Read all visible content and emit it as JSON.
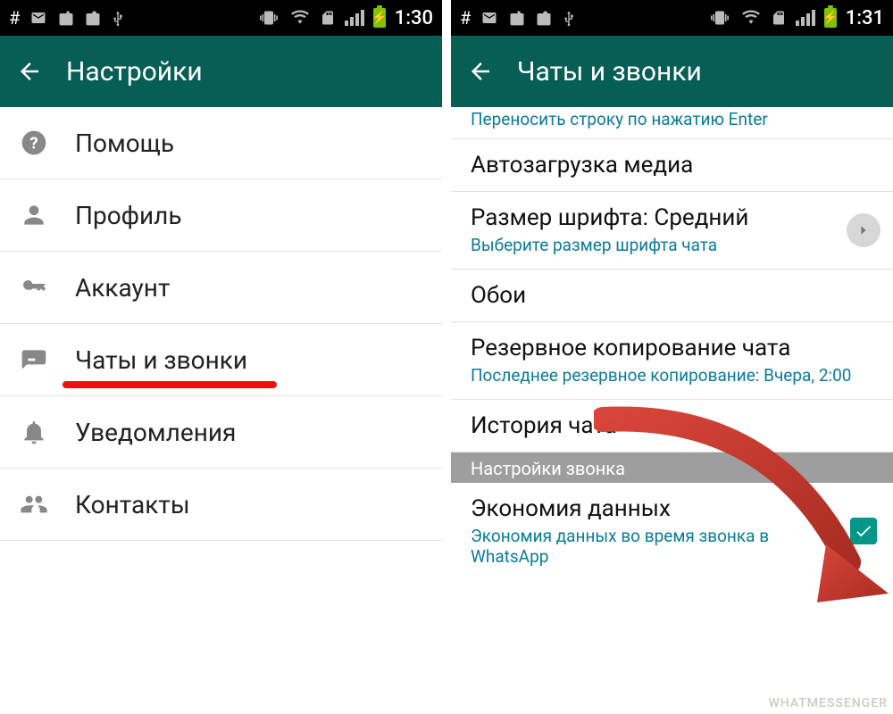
{
  "left": {
    "status_time": "1:30",
    "appbar_title": "Настройки",
    "items": [
      {
        "label": "Помощь"
      },
      {
        "label": "Профиль"
      },
      {
        "label": "Аккаунт"
      },
      {
        "label": "Чаты и звонки",
        "underlined": true
      },
      {
        "label": "Уведомления"
      },
      {
        "label": "Контакты"
      }
    ]
  },
  "right": {
    "status_time": "1:31",
    "appbar_title": "Чаты и звонки",
    "top_cut_text": "Переносить строку по нажатию Enter",
    "items": [
      {
        "title": "Автозагрузка медиа"
      },
      {
        "title": "Размер шрифта: Средний",
        "sub": "Выберите размер шрифта чата",
        "chevron": true
      },
      {
        "title": "Обои"
      },
      {
        "title": "Резервное копирование чата",
        "sub": "Последнее резервное копирование: Вчера, 2:00"
      },
      {
        "title": "История чата"
      }
    ],
    "section_header": "Настройки звонка",
    "data_saving": {
      "title": "Экономия данных",
      "sub": "Экономия данных во время звонка в WhatsApp",
      "checked": true
    }
  },
  "watermark": "WHATMESSENGER",
  "colors": {
    "whatsapp_teal": "#075e54",
    "accent": "#009688",
    "subtext_link": "#0a7b9b",
    "highlight_red": "#e11"
  }
}
